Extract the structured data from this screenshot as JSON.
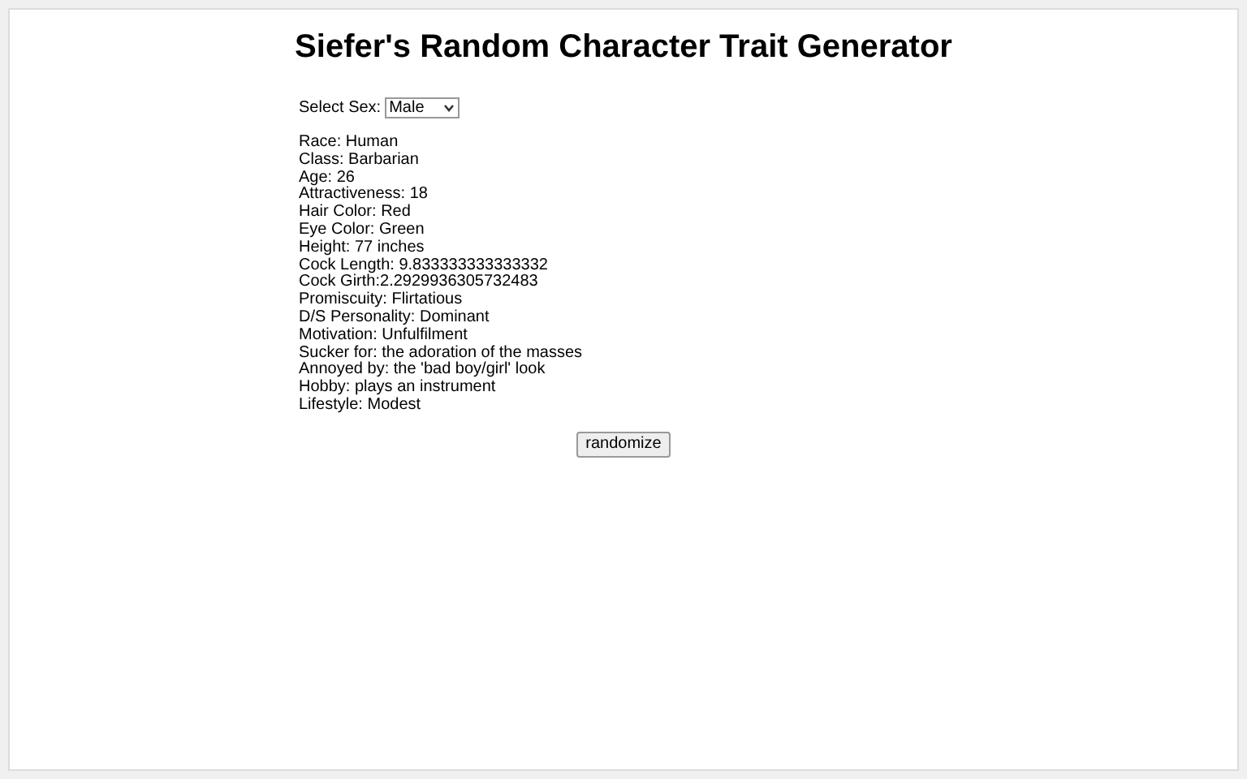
{
  "title": "Siefer's Random Character Trait Generator",
  "sex_select": {
    "label": "Select Sex:",
    "value": "Male"
  },
  "traits": [
    "Race: Human",
    "Class: Barbarian",
    "Age: 26",
    "Attractiveness: 18",
    "Hair Color: Red",
    "Eye Color: Green",
    "Height: 77 inches",
    "Cock Length: 9.833333333333332",
    "Cock Girth:2.2929936305732483",
    "Promiscuity: Flirtatious",
    "D/S Personality: Dominant",
    "Motivation: Unfulfilment",
    "Sucker for: the adoration of the masses",
    "Annoyed by: the 'bad boy/girl' look",
    "Hobby: plays an instrument",
    "Lifestyle: Modest"
  ],
  "button": "randomize"
}
